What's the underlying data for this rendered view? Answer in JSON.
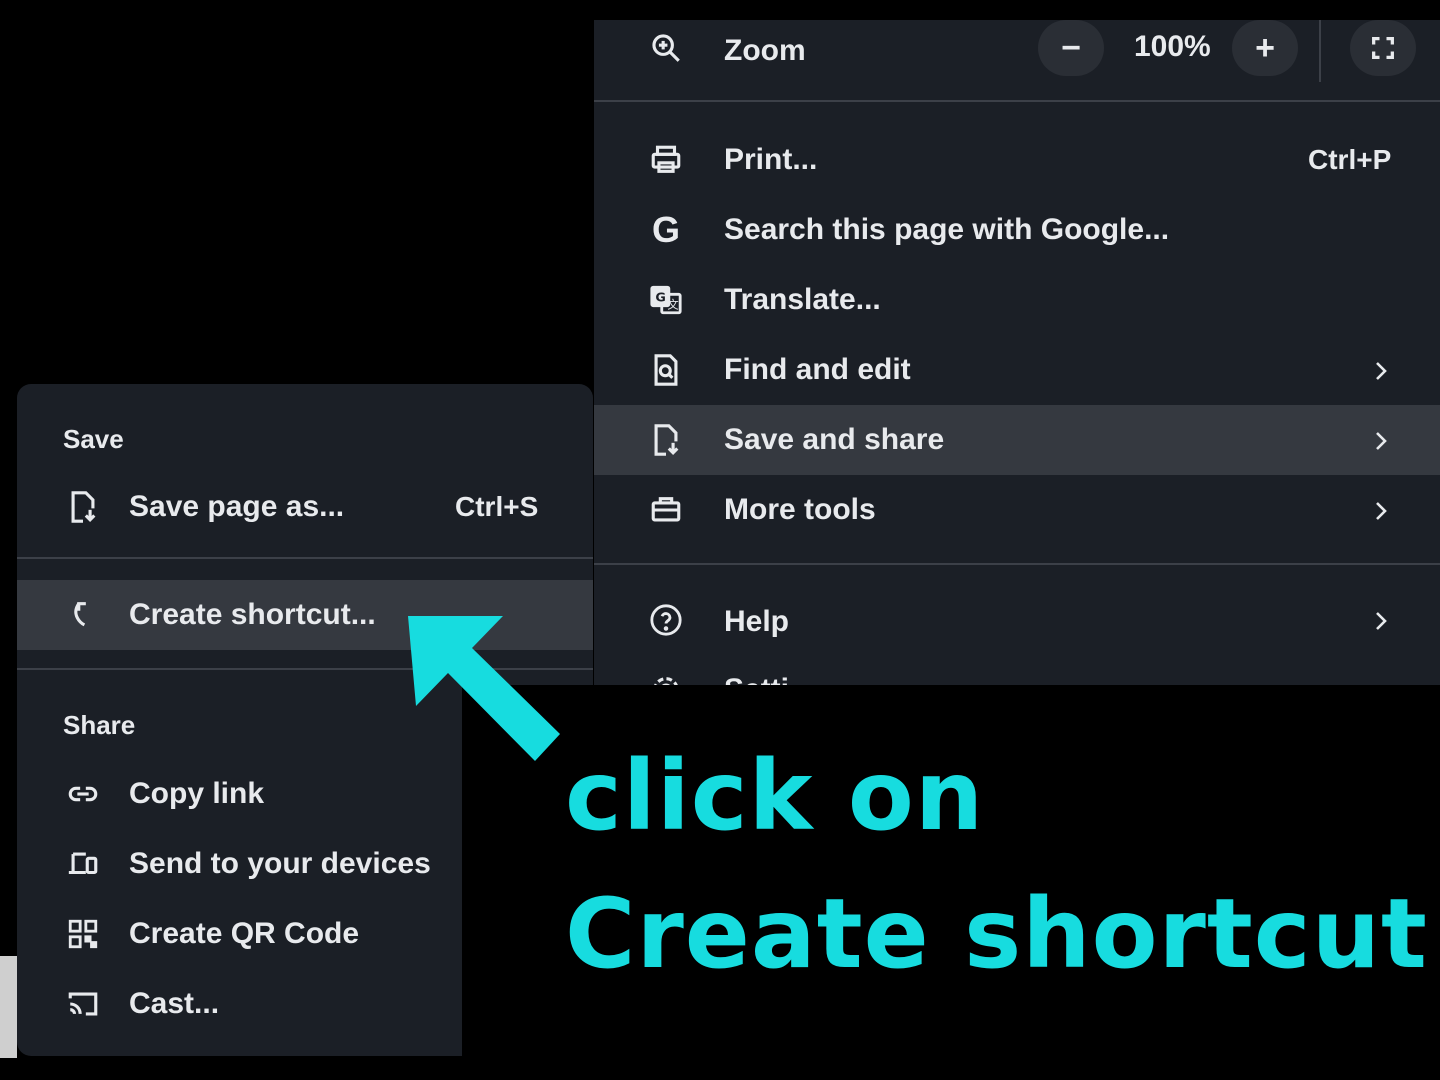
{
  "main_menu": {
    "zoom": {
      "label": "Zoom",
      "decrease": "−",
      "value": "100%",
      "increase": "+"
    },
    "items": [
      {
        "label": "Print...",
        "shortcut": "Ctrl+P"
      },
      {
        "label": "Search this page with Google..."
      },
      {
        "label": "Translate..."
      },
      {
        "label": "Find and edit"
      },
      {
        "label": "Save and share"
      },
      {
        "label": "More tools"
      },
      {
        "label": "Help"
      },
      {
        "label": "Setti"
      }
    ]
  },
  "sub_menu": {
    "save_header": "Save",
    "save_page": {
      "label": "Save page as...",
      "shortcut": "Ctrl+S"
    },
    "create_shortcut": {
      "label": "Create shortcut..."
    },
    "share_header": "Share",
    "share_items": [
      {
        "label": "Copy link"
      },
      {
        "label": "Send to your devices"
      },
      {
        "label": "Create QR Code"
      },
      {
        "label": "Cast..."
      }
    ]
  },
  "annotation": {
    "line1": "click on",
    "line2": "Create shortcut",
    "color": "#17dcdf"
  },
  "colors": {
    "menu_bg": "#1b1f26",
    "highlight": "#353940",
    "accent": "#17dcdf"
  }
}
